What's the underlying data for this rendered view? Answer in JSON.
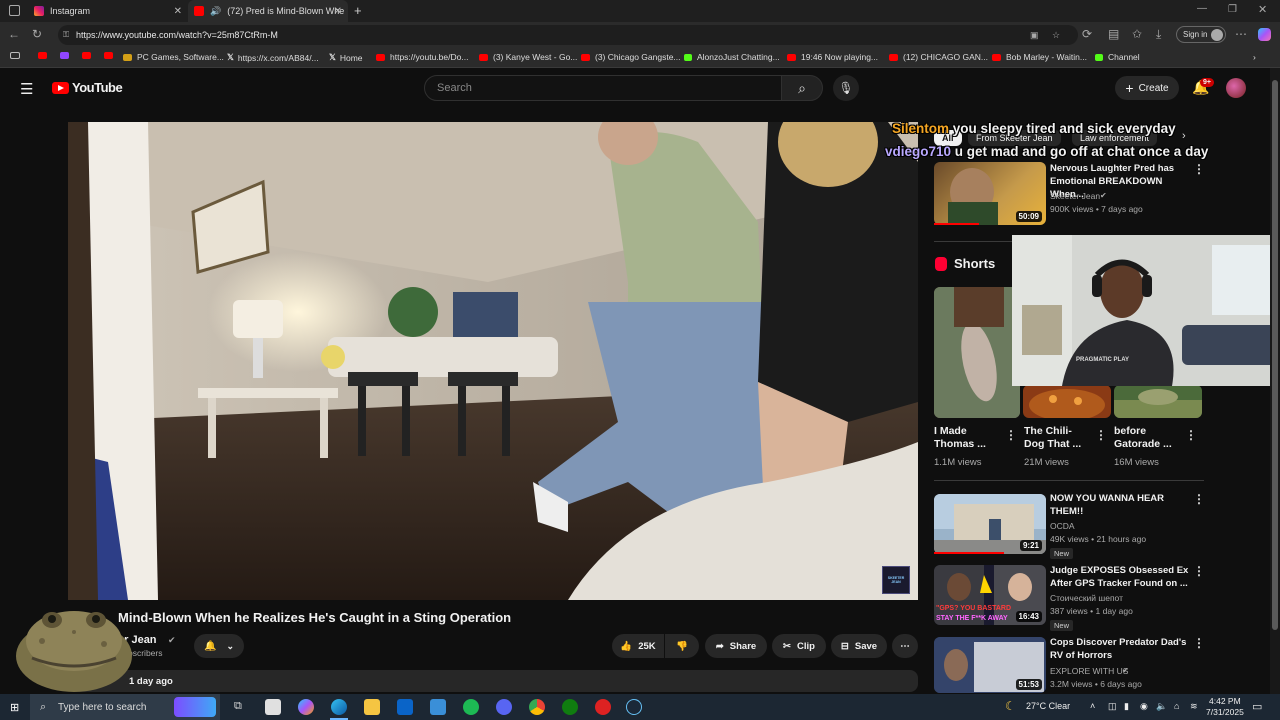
{
  "browser": {
    "tabs": [
      {
        "label": "Instagram",
        "active": false
      },
      {
        "label": "(72) Pred is Mind-Blown Whe",
        "active": true
      }
    ],
    "url": "https://www.youtube.com/watch?v=25m87CtRm-M",
    "signin_label": "Sign in",
    "bookmarks": [
      "PC Games, Software...",
      "https://x.com/AB84/...",
      "Home",
      "https://youtu.be/Do...",
      "(3) Kanye West - Go...",
      "(3) Chicago Gangste...",
      "AlonzoJust Chatting...",
      "19:46 Now playing...",
      "(12) CHICAGO GAN...",
      "Bob Marley - Waitin...",
      "Channel"
    ]
  },
  "youtube": {
    "logo_text": "YouTube",
    "search_placeholder": "Search",
    "create_label": "Create",
    "notif_count": "9+"
  },
  "video": {
    "title": "Mind-Blown When he Realizes He's Caught in a Sting Operation",
    "channel": "er Jean",
    "subs": "bscribers",
    "likes": "25K",
    "share_label": "Share",
    "clip_label": "Clip",
    "save_label": "Save",
    "views_short": "...",
    "date": "1 day ago",
    "watermark": "SKEETER JEAN"
  },
  "chat_overlay": [
    {
      "user": "Silentom",
      "msg": "you sleepy tired and sick everyday",
      "color": "#f5a623"
    },
    {
      "user": "vdiego710",
      "msg": "u get mad and go off at chat once a day",
      "color": "#b9a8ff"
    }
  ],
  "filter_chips": [
    "All",
    "From Skeeter Jean",
    "Law enforcement"
  ],
  "related": [
    {
      "title": "Nervous Laughter Pred has Emotional BREAKDOWN When...",
      "channel": "Skeeter Jean",
      "meta": "900K views • 7 days ago",
      "duration": "50:09",
      "verified": true
    },
    {
      "title": "NOW YOU WANNA HEAR THEM!!",
      "channel": "OCDA",
      "meta": "49K views • 21 hours ago",
      "duration": "9:21",
      "badge": "New"
    },
    {
      "title": "Judge EXPOSES Obsessed Ex After GPS Tracker Found on ...",
      "channel": "Стоический шепот",
      "meta": "387 views • 1 day ago",
      "duration": "16:43",
      "badge": "New"
    },
    {
      "title": "Cops Discover Predator Dad's RV of Horrors",
      "channel": "EXPLORE WITH US",
      "meta": "3.2M views • 6 days ago",
      "duration": "51:53",
      "verified": true
    }
  ],
  "shorts": {
    "heading": "Shorts",
    "items": [
      {
        "title": "I Made Thomas ...",
        "views": "1.1M views"
      },
      {
        "title": "The Chili-Dog That ...",
        "views": "21M views"
      },
      {
        "title": "before Gatorade ...",
        "views": "16M views"
      }
    ]
  },
  "webcam": {
    "shirt_text": "PRAGMATIC PLAY"
  },
  "thumb_texts": {
    "judge": "\"GPS? YOU BASTARD",
    "judge2": "STAY THE F**K AWAY"
  },
  "taskbar": {
    "search_placeholder": "Type here to search",
    "weather": "27°C  Clear",
    "time": "4:42 PM",
    "date": "7/31/2025"
  },
  "colors": {
    "youtube_red": "#ff0000",
    "bg": "#0f0f0f"
  }
}
